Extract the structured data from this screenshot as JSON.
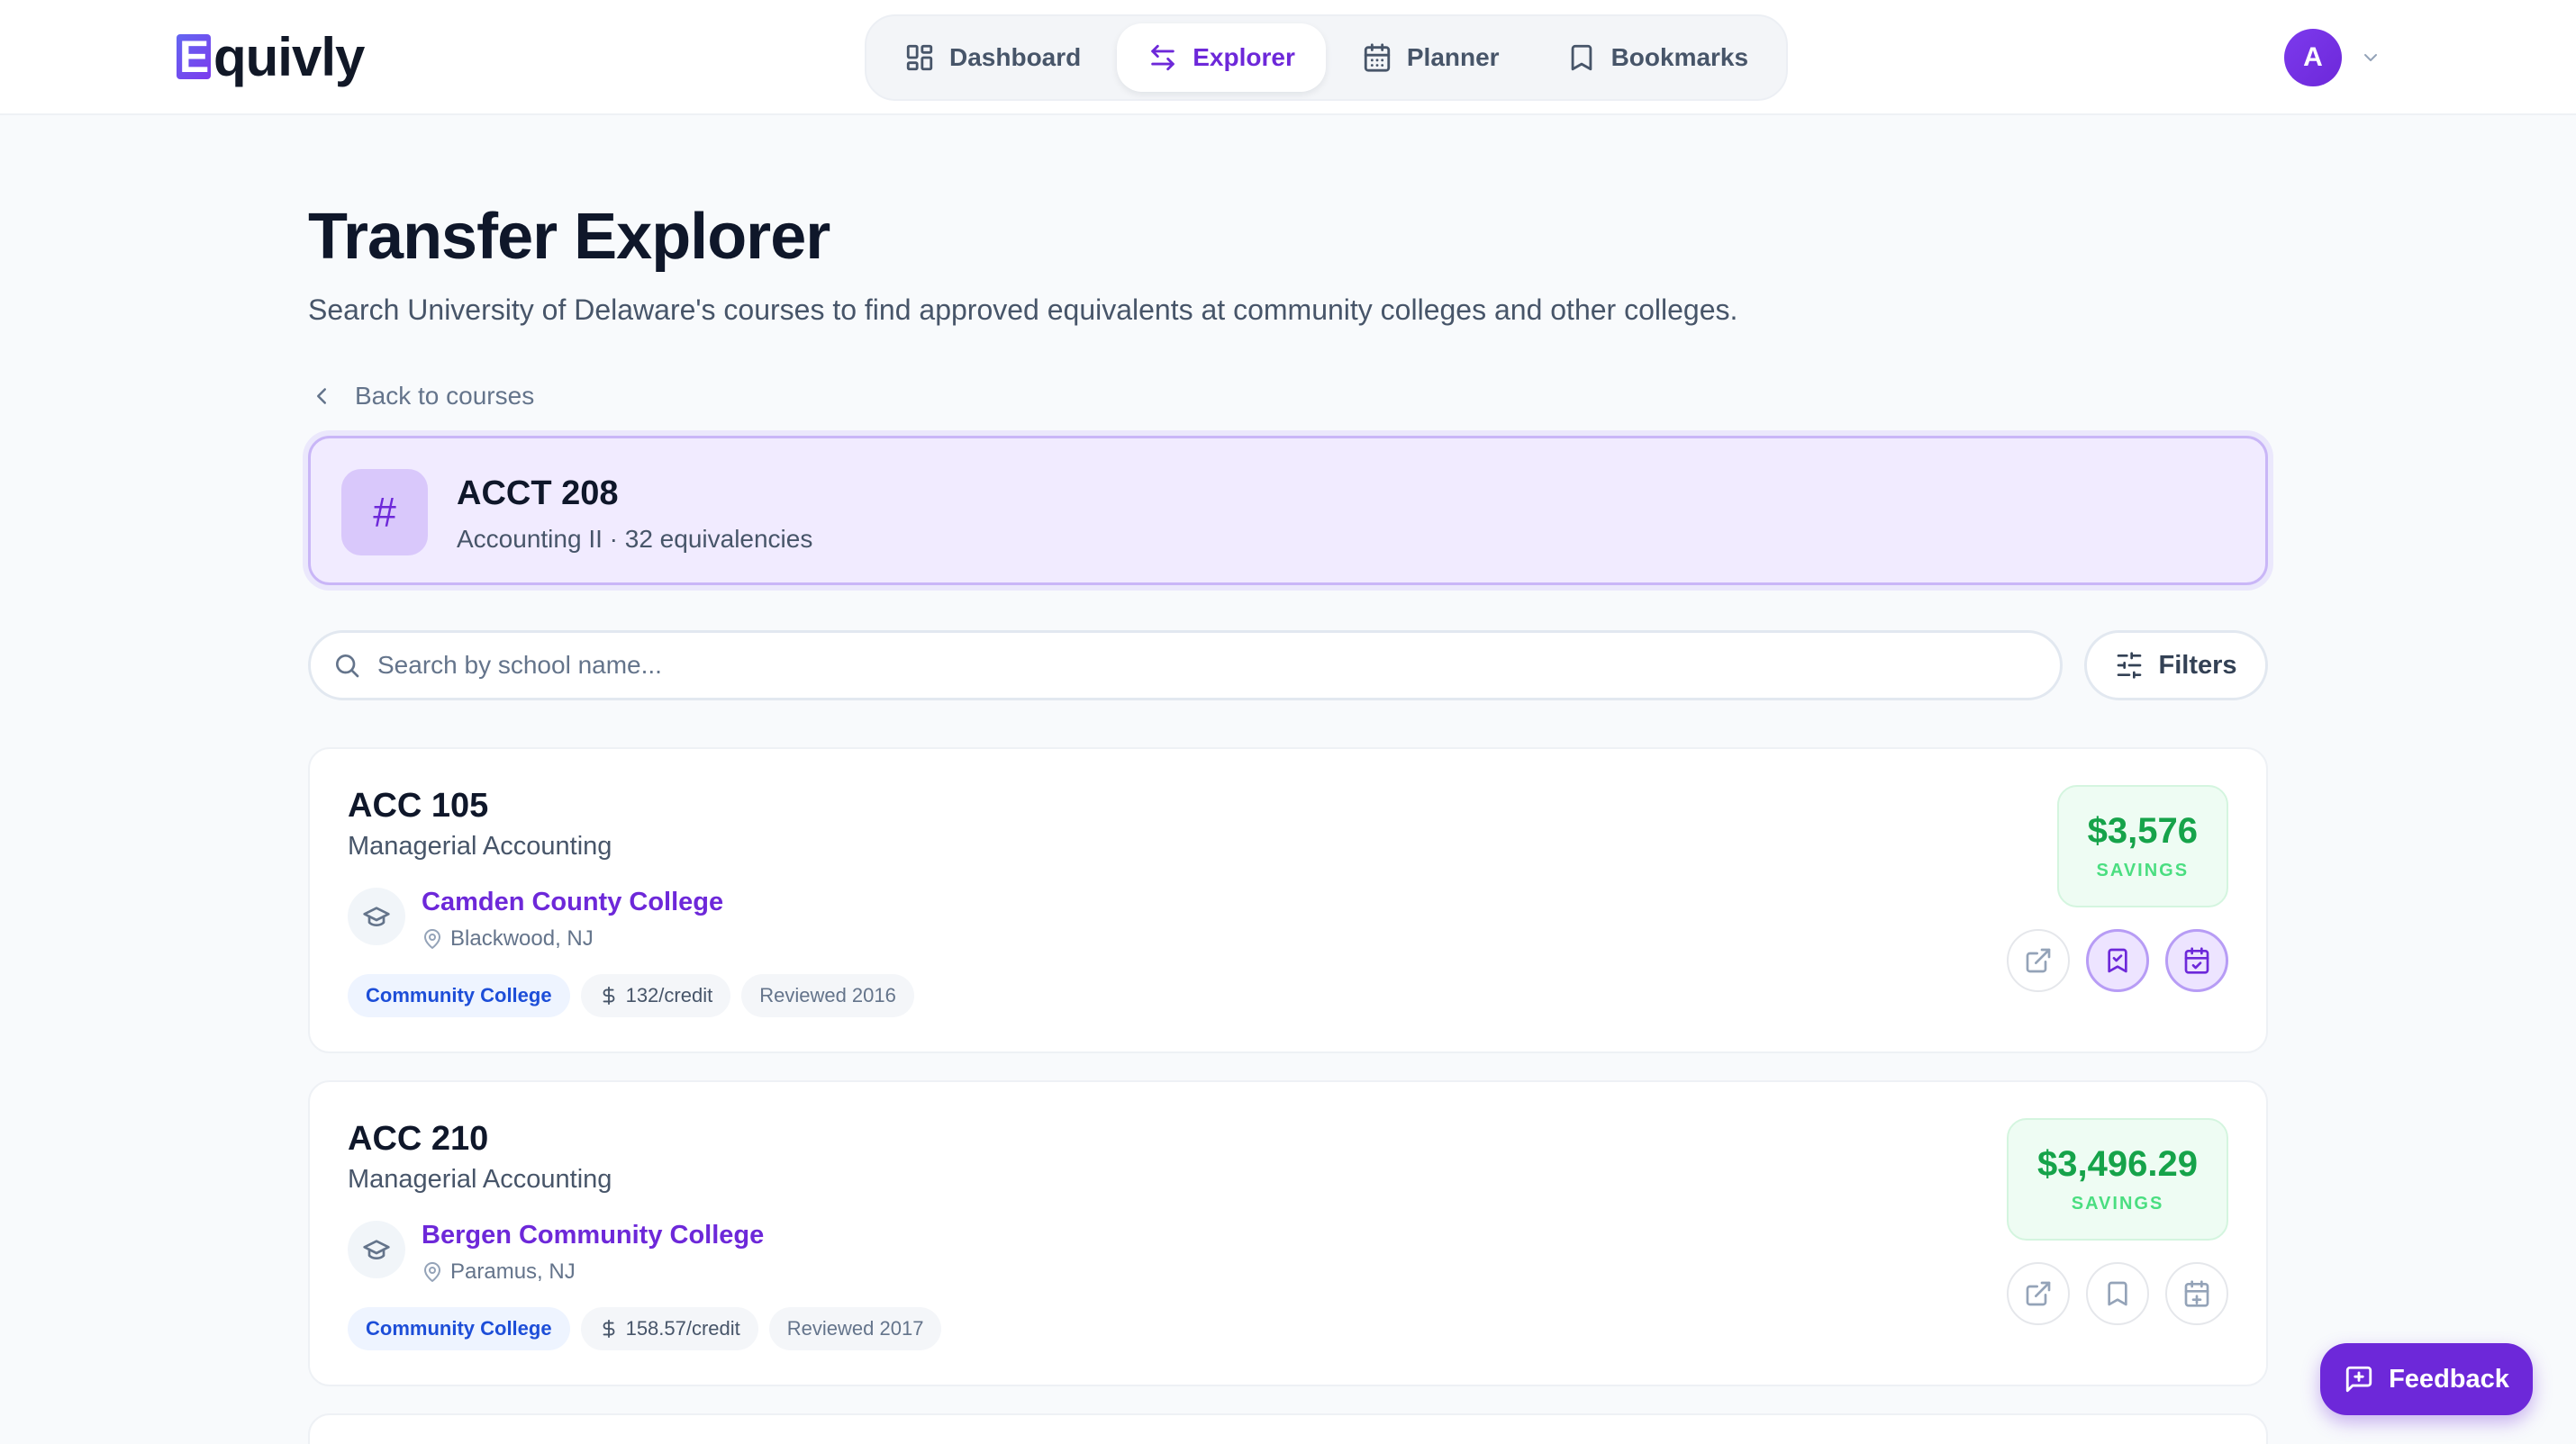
{
  "app": {
    "logo_initial": "E",
    "logo_rest": "quivly"
  },
  "nav": {
    "items": [
      {
        "label": "Dashboard",
        "icon": "dashboard-grid-icon",
        "active": false
      },
      {
        "label": "Explorer",
        "icon": "transfer-arrows-icon",
        "active": true
      },
      {
        "label": "Planner",
        "icon": "calendar-icon",
        "active": false
      },
      {
        "label": "Bookmarks",
        "icon": "bookmark-icon",
        "active": false
      }
    ]
  },
  "user": {
    "avatar_initial": "A"
  },
  "page": {
    "title": "Transfer Explorer",
    "subtitle": "Search University of Delaware's courses to find approved equivalents at community colleges and other colleges.",
    "back_label": "Back to courses"
  },
  "course": {
    "code": "ACCT 208",
    "meta": "Accounting II · 32 equivalencies",
    "icon_glyph": "#"
  },
  "search": {
    "placeholder": "Search by school name...",
    "value": ""
  },
  "filters": {
    "label": "Filters"
  },
  "results": [
    {
      "code": "ACC 105",
      "name": "Managerial Accounting",
      "school": "Camden County College",
      "location": "Blackwood, NJ",
      "type": "Community College",
      "cost": "132/credit",
      "reviewed": "Reviewed 2016",
      "savings_amount": "$3,576",
      "savings_label": "SAVINGS",
      "bookmarked": true,
      "planned": true
    },
    {
      "code": "ACC 210",
      "name": "Managerial Accounting",
      "school": "Bergen Community College",
      "location": "Paramus, NJ",
      "type": "Community College",
      "cost": "158.57/credit",
      "reviewed": "Reviewed 2017",
      "savings_amount": "$3,496.29",
      "savings_label": "SAVINGS",
      "bookmarked": false,
      "planned": false
    }
  ],
  "feedback": {
    "label": "Feedback"
  },
  "colors": {
    "accent": "#6d28d9",
    "savings_green": "#16a34a",
    "tag_blue": "#1d4ed8",
    "banner_bg": "#f1ebff"
  }
}
